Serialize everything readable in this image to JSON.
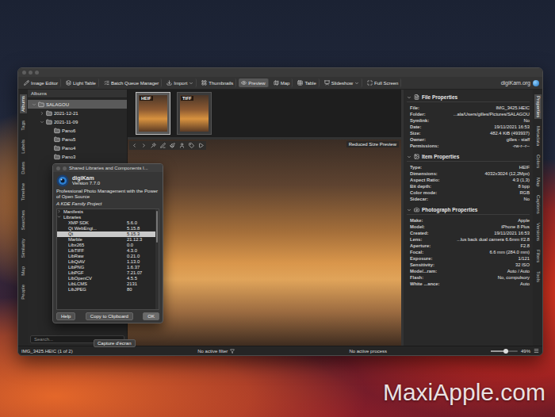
{
  "window": {
    "brand": "digiKam.org"
  },
  "toolbar": [
    {
      "label": "Image Editor",
      "selected": false,
      "menu": false
    },
    {
      "label": "Light Table",
      "selected": false,
      "menu": false
    },
    {
      "label": "Batch Queue Manager",
      "selected": false,
      "menu": false
    },
    {
      "label": "Import",
      "selected": false,
      "menu": true
    },
    {
      "label": "Thumbnails",
      "selected": false,
      "menu": false
    },
    {
      "label": "Preview",
      "selected": true,
      "menu": false
    },
    {
      "label": "Map",
      "selected": false,
      "menu": false
    },
    {
      "label": "Table",
      "selected": false,
      "menu": false
    },
    {
      "label": "Slideshow",
      "selected": false,
      "menu": true
    },
    {
      "label": "Full Screen",
      "selected": false,
      "menu": false
    }
  ],
  "left_tabs": [
    {
      "label": "Albums",
      "selected": true
    },
    {
      "label": "Tags",
      "selected": false
    },
    {
      "label": "Labels",
      "selected": false
    },
    {
      "label": "Dates",
      "selected": false
    },
    {
      "label": "Timeline",
      "selected": false
    },
    {
      "label": "Searches",
      "selected": false
    },
    {
      "label": "Similarity",
      "selected": false
    },
    {
      "label": "Map",
      "selected": false
    },
    {
      "label": "People",
      "selected": false
    }
  ],
  "albums": {
    "header": "Albums",
    "items": [
      {
        "label": "SALAGOU",
        "depth": 0,
        "children": true,
        "expanded": true,
        "selected": true
      },
      {
        "label": "2021-12-21",
        "depth": 1,
        "children": true,
        "expanded": false,
        "selected": false
      },
      {
        "label": "2021-11-09",
        "depth": 1,
        "children": true,
        "expanded": true,
        "selected": false
      },
      {
        "label": "Pano6",
        "depth": 2,
        "children": false,
        "expanded": false,
        "selected": false
      },
      {
        "label": "Pano5",
        "depth": 2,
        "children": false,
        "expanded": false,
        "selected": false
      },
      {
        "label": "Pano4",
        "depth": 2,
        "children": false,
        "expanded": false,
        "selected": false
      },
      {
        "label": "Pano3",
        "depth": 2,
        "children": false,
        "expanded": false,
        "selected": false
      }
    ],
    "search": {
      "placeholder": "Search..."
    }
  },
  "thumbnails": [
    {
      "badge": "HEIF",
      "selected": true
    },
    {
      "badge": "TIFF",
      "selected": false
    }
  ],
  "preview": {
    "label": "Reduced Size Preview"
  },
  "dialog": {
    "title": "Shared Libraries and Components I...",
    "app": "digiKam",
    "version": "Version 7.7.0",
    "description": "Professional Photo Management with the Power of Open Source",
    "family": "A KDE Family Project",
    "rows": [
      {
        "name": "Manifests",
        "value": "",
        "group": true,
        "expanded": false,
        "selected": false
      },
      {
        "name": "Libraries",
        "value": "",
        "group": true,
        "expanded": true,
        "selected": false
      },
      {
        "name": "XMP SDK",
        "value": "5.6.0",
        "group": false,
        "expanded": false,
        "selected": false
      },
      {
        "name": "Qt WebEngi...",
        "value": "5.15.8",
        "group": false,
        "expanded": false,
        "selected": false
      },
      {
        "name": "Qt",
        "value": "5.15.3",
        "group": false,
        "expanded": false,
        "selected": true
      },
      {
        "name": "Marble",
        "value": "21.12.3",
        "group": false,
        "expanded": false,
        "selected": false
      },
      {
        "name": "Libx265",
        "value": "0.0",
        "group": false,
        "expanded": false,
        "selected": false
      },
      {
        "name": "LibTIFF",
        "value": "4.3.0",
        "group": false,
        "expanded": false,
        "selected": false
      },
      {
        "name": "LibRaw",
        "value": "0.21.0",
        "group": false,
        "expanded": false,
        "selected": false
      },
      {
        "name": "LibQtAV",
        "value": "1.13.0",
        "group": false,
        "expanded": false,
        "selected": false
      },
      {
        "name": "LibPNG",
        "value": "1.6.37",
        "group": false,
        "expanded": false,
        "selected": false
      },
      {
        "name": "LibPGF",
        "value": "7.21.07",
        "group": false,
        "expanded": false,
        "selected": false
      },
      {
        "name": "LibOpenCV",
        "value": "4.5.5",
        "group": false,
        "expanded": false,
        "selected": false
      },
      {
        "name": "LibLCMS",
        "value": "2131",
        "group": false,
        "expanded": false,
        "selected": false
      },
      {
        "name": "LibJPEG",
        "value": "80",
        "group": false,
        "expanded": false,
        "selected": false
      }
    ],
    "buttons": [
      {
        "label": "Help",
        "default": false
      },
      {
        "label": "Copy to Clipboard",
        "default": false
      },
      {
        "label": "OK",
        "default": true
      }
    ]
  },
  "sections": [
    {
      "title": "File Properties",
      "rows": [
        {
          "label": "File:",
          "value": "IMG_3425.HEIC"
        },
        {
          "label": "Folder:",
          "value": "...ala/Users/gilles/Pictures/SALAGOU"
        },
        {
          "label": "Symlink:",
          "value": "No"
        },
        {
          "label": "Date:",
          "value": "19/11/2021 16:53"
        },
        {
          "label": "Size:",
          "value": "482.4 KiB (493937)"
        },
        {
          "label": "Owner:",
          "value": "gilles - staff"
        },
        {
          "label": "Permissions:",
          "value": "-rw-r--r--"
        }
      ]
    },
    {
      "title": "Item Properties",
      "rows": [
        {
          "label": "Type:",
          "value": "HEIF"
        },
        {
          "label": "Dimensions:",
          "value": "4032x3024 (12,2Mpx)"
        },
        {
          "label": "Aspect Ratio:",
          "value": "4:3 (1,3)"
        },
        {
          "label": "Bit depth:",
          "value": "8 bpp"
        },
        {
          "label": "Color mode:",
          "value": "RGB"
        },
        {
          "label": "Sidecar:",
          "value": "No"
        }
      ]
    },
    {
      "title": "Photograph Properties",
      "rows": [
        {
          "label": "Make:",
          "value": "Apple"
        },
        {
          "label": "Model:",
          "value": "iPhone 8 Plus"
        },
        {
          "label": "Created:",
          "value": "19/11/2021 16:53"
        },
        {
          "label": "Lens:",
          "value": "...lus back dual camera 6.6mm f/2.8"
        },
        {
          "label": "Aperture:",
          "value": "F2.8"
        },
        {
          "label": "Focal:",
          "value": "6.6 mm (284.0 mm)"
        },
        {
          "label": "Exposure:",
          "value": "1/121"
        },
        {
          "label": "Sensitivity:",
          "value": "32 ISO"
        },
        {
          "label": "Mode/...ram:",
          "value": "Auto / Auto"
        },
        {
          "label": "Flash:",
          "value": "No, compulsory"
        },
        {
          "label": "White ...ance:",
          "value": "Auto"
        }
      ]
    }
  ],
  "right_tabs": [
    {
      "label": "Properties",
      "selected": true
    },
    {
      "label": "Metadata",
      "selected": false
    },
    {
      "label": "Colors",
      "selected": false
    },
    {
      "label": "Map",
      "selected": false
    },
    {
      "label": "Captions",
      "selected": false
    },
    {
      "label": "Versions",
      "selected": false
    },
    {
      "label": "Filters",
      "selected": false
    },
    {
      "label": "Tools",
      "selected": false
    }
  ],
  "status_bar": {
    "file": "IMG_3425.HEIC (1 of 2)",
    "filter": "No active filter",
    "process": "No active process",
    "zoom": {
      "level": 0.55,
      "reading": "49%"
    }
  },
  "tooltip": "Capture d'écran",
  "watermark": "MaxiApple.com"
}
